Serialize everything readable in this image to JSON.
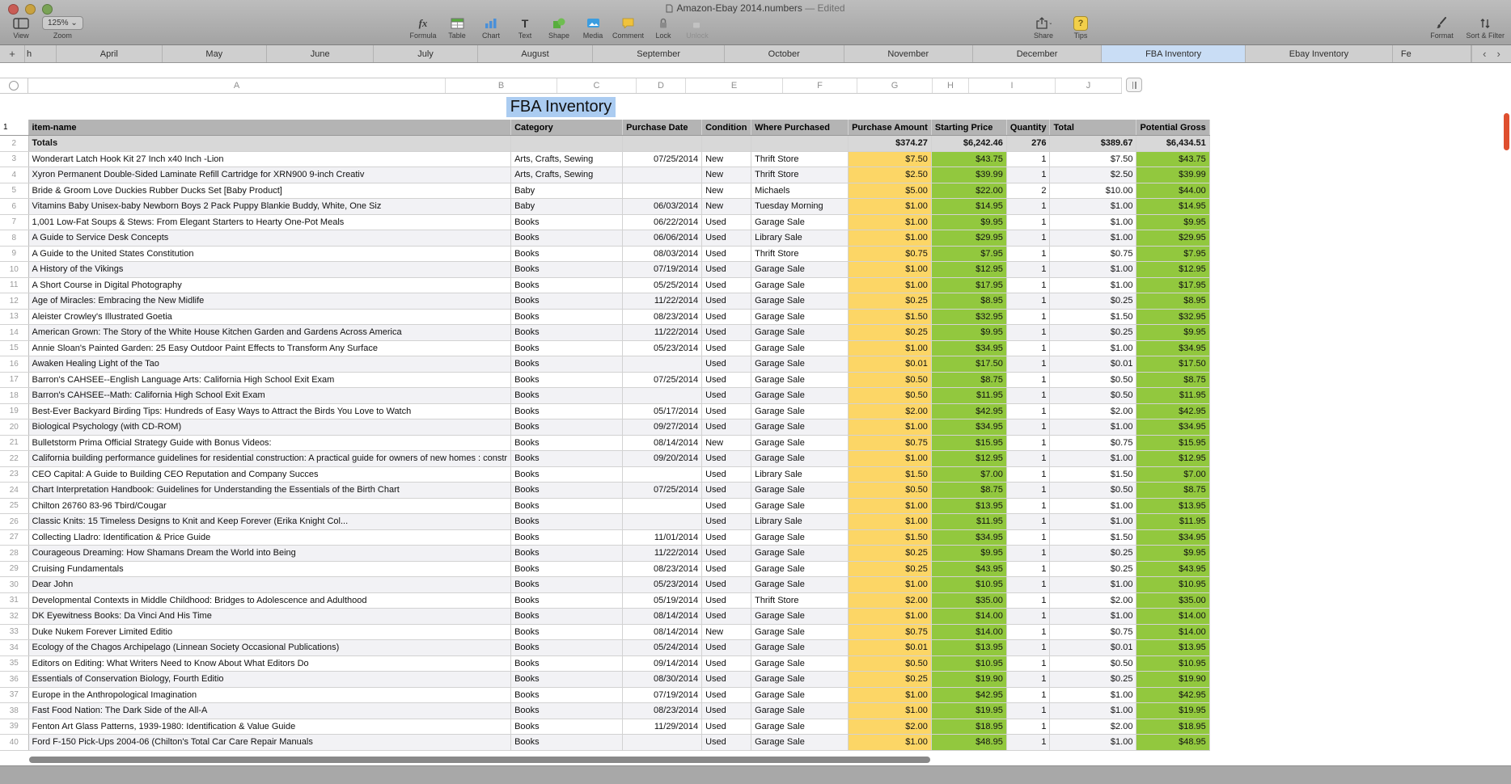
{
  "window": {
    "title": "Amazon-Ebay 2014.numbers",
    "edited": "— Edited"
  },
  "toolbar": {
    "view": {
      "label": "View"
    },
    "zoom": {
      "label": "Zoom",
      "value": "125%"
    },
    "formula": {
      "label": "Formula",
      "glyph": "fx"
    },
    "table": {
      "label": "Table"
    },
    "chart": {
      "label": "Chart"
    },
    "text": {
      "label": "Text",
      "glyph": "T"
    },
    "shape": {
      "label": "Shape"
    },
    "media": {
      "label": "Media"
    },
    "comment": {
      "label": "Comment"
    },
    "lock": {
      "label": "Lock"
    },
    "unlock": {
      "label": "Unlock"
    },
    "share": {
      "label": "Share"
    },
    "tips": {
      "label": "Tips",
      "glyph": "?"
    },
    "format": {
      "label": "Format"
    },
    "sort_filter": {
      "label": "Sort & Filter"
    }
  },
  "tabs": {
    "add": "+",
    "prev": "‹",
    "next": "›",
    "selected": "FBA Inventory",
    "items": [
      "h",
      "April",
      "May",
      "June",
      "July",
      "August",
      "September",
      "October",
      "November",
      "December",
      "FBA Inventory",
      "Ebay Inventory",
      "Fe"
    ]
  },
  "columns_bar": {
    "letters": [
      "A",
      "B",
      "C",
      "D",
      "E",
      "F",
      "G",
      "H",
      "I",
      "J"
    ]
  },
  "sheet": {
    "title": "FBA Inventory",
    "headers": [
      "item-name",
      "Category",
      "Purchase Date",
      "Condition",
      "Where Purchased",
      "Purchase Amount",
      "Starting Price",
      "Quantity",
      "Total",
      "Potential Gross"
    ],
    "totals": [
      "Totals",
      "",
      "",
      "",
      "",
      "$374.27",
      "$6,242.46",
      "276",
      "$389.67",
      "$6,434.51"
    ],
    "rows": [
      [
        "Wonderart Latch Hook Kit 27 Inch x40 Inch -Lion",
        "Arts, Crafts, Sewing",
        "07/25/2014",
        "New",
        "Thrift Store",
        "$7.50",
        "$43.75",
        "1",
        "$7.50",
        "$43.75"
      ],
      [
        "Xyron Permanent Double-Sided Laminate Refill Cartridge for XRN900 9-inch Creativ",
        "Arts, Crafts, Sewing",
        "",
        "New",
        "Thrift Store",
        "$2.50",
        "$39.99",
        "1",
        "$2.50",
        "$39.99"
      ],
      [
        "Bride & Groom Love Duckies Rubber Ducks Set [Baby Product]",
        "Baby",
        "",
        "New",
        "Michaels",
        "$5.00",
        "$22.00",
        "2",
        "$10.00",
        "$44.00"
      ],
      [
        "Vitamins Baby Unisex-baby Newborn Boys 2 Pack Puppy Blankie Buddy, White, One Siz",
        "Baby",
        "06/03/2014",
        "New",
        "Tuesday Morning",
        "$1.00",
        "$14.95",
        "1",
        "$1.00",
        "$14.95"
      ],
      [
        "1,001 Low-Fat Soups & Stews: From Elegant Starters to Hearty One-Pot Meals",
        "Books",
        "06/22/2014",
        "Used",
        "Garage Sale",
        "$1.00",
        "$9.95",
        "1",
        "$1.00",
        "$9.95"
      ],
      [
        "A Guide to Service Desk Concepts",
        "Books",
        "06/06/2014",
        "Used",
        "Library Sale",
        "$1.00",
        "$29.95",
        "1",
        "$1.00",
        "$29.95"
      ],
      [
        "A Guide to the United States Constitution",
        "Books",
        "08/03/2014",
        "Used",
        "Thrift Store",
        "$0.75",
        "$7.95",
        "1",
        "$0.75",
        "$7.95"
      ],
      [
        "A History of the Vikings",
        "Books",
        "07/19/2014",
        "Used",
        "Garage Sale",
        "$1.00",
        "$12.95",
        "1",
        "$1.00",
        "$12.95"
      ],
      [
        "A Short Course in Digital Photography",
        "Books",
        "05/25/2014",
        "Used",
        "Garage Sale",
        "$1.00",
        "$17.95",
        "1",
        "$1.00",
        "$17.95"
      ],
      [
        "Age of Miracles: Embracing the New Midlife",
        "Books",
        "11/22/2014",
        "Used",
        "Garage Sale",
        "$0.25",
        "$8.95",
        "1",
        "$0.25",
        "$8.95"
      ],
      [
        "Aleister Crowley's Illustrated Goetia",
        "Books",
        "08/23/2014",
        "Used",
        "Garage Sale",
        "$1.50",
        "$32.95",
        "1",
        "$1.50",
        "$32.95"
      ],
      [
        "American Grown: The Story of the White House Kitchen Garden and Gardens Across America",
        "Books",
        "11/22/2014",
        "Used",
        "Garage Sale",
        "$0.25",
        "$9.95",
        "1",
        "$0.25",
        "$9.95"
      ],
      [
        "Annie Sloan's Painted Garden: 25 Easy Outdoor Paint Effects to Transform Any Surface",
        "Books",
        "05/23/2014",
        "Used",
        "Garage Sale",
        "$1.00",
        "$34.95",
        "1",
        "$1.00",
        "$34.95"
      ],
      [
        "Awaken Healing Light of the Tao",
        "Books",
        "",
        "Used",
        "Garage Sale",
        "$0.01",
        "$17.50",
        "1",
        "$0.01",
        "$17.50"
      ],
      [
        "Barron's CAHSEE--English Language Arts: California High School Exit Exam",
        "Books",
        "07/25/2014",
        "Used",
        "Garage Sale",
        "$0.50",
        "$8.75",
        "1",
        "$0.50",
        "$8.75"
      ],
      [
        "Barron's CAHSEE--Math: California High School Exit Exam",
        "Books",
        "",
        "Used",
        "Garage Sale",
        "$0.50",
        "$11.95",
        "1",
        "$0.50",
        "$11.95"
      ],
      [
        "Best-Ever Backyard Birding Tips: Hundreds of Easy Ways to Attract the Birds You Love to Watch",
        "Books",
        "05/17/2014",
        "Used",
        "Garage Sale",
        "$2.00",
        "$42.95",
        "1",
        "$2.00",
        "$42.95"
      ],
      [
        "Biological Psychology (with CD-ROM)",
        "Books",
        "09/27/2014",
        "Used",
        "Garage Sale",
        "$1.00",
        "$34.95",
        "1",
        "$1.00",
        "$34.95"
      ],
      [
        "Bulletstorm Prima Official Strategy Guide with Bonus Videos:",
        "Books",
        "08/14/2014",
        "New",
        "Garage Sale",
        "$0.75",
        "$15.95",
        "1",
        "$0.75",
        "$15.95"
      ],
      [
        "California building performance guidelines for residential construction: A practical guide for owners of new homes : constr",
        "Books",
        "09/20/2014",
        "Used",
        "Garage Sale",
        "$1.00",
        "$12.95",
        "1",
        "$1.00",
        "$12.95"
      ],
      [
        "CEO Capital: A Guide to Building CEO Reputation and Company Succes",
        "Books",
        "",
        "Used",
        "Library Sale",
        "$1.50",
        "$7.00",
        "1",
        "$1.50",
        "$7.00"
      ],
      [
        "Chart Interpretation Handbook: Guidelines for Understanding the Essentials of the Birth Chart",
        "Books",
        "07/25/2014",
        "Used",
        "Garage Sale",
        "$0.50",
        "$8.75",
        "1",
        "$0.50",
        "$8.75"
      ],
      [
        "Chilton 26760 83-96 Tbird/Cougar",
        "Books",
        "",
        "Used",
        "Garage Sale",
        "$1.00",
        "$13.95",
        "1",
        "$1.00",
        "$13.95"
      ],
      [
        "Classic Knits: 15 Timeless Designs to Knit and Keep Forever (Erika Knight Col...",
        "Books",
        "",
        "Used",
        "Library Sale",
        "$1.00",
        "$11.95",
        "1",
        "$1.00",
        "$11.95"
      ],
      [
        "Collecting Lladro: Identification & Price Guide",
        "Books",
        "11/01/2014",
        "Used",
        "Garage Sale",
        "$1.50",
        "$34.95",
        "1",
        "$1.50",
        "$34.95"
      ],
      [
        "Courageous Dreaming: How Shamans Dream the World into Being",
        "Books",
        "11/22/2014",
        "Used",
        "Garage Sale",
        "$0.25",
        "$9.95",
        "1",
        "$0.25",
        "$9.95"
      ],
      [
        "Cruising Fundamentals",
        "Books",
        "08/23/2014",
        "Used",
        "Garage Sale",
        "$0.25",
        "$43.95",
        "1",
        "$0.25",
        "$43.95"
      ],
      [
        "Dear John",
        "Books",
        "05/23/2014",
        "Used",
        "Garage Sale",
        "$1.00",
        "$10.95",
        "1",
        "$1.00",
        "$10.95"
      ],
      [
        "Developmental Contexts in Middle Childhood: Bridges to Adolescence and Adulthood",
        "Books",
        "05/19/2014",
        "Used",
        "Thrift Store",
        "$2.00",
        "$35.00",
        "1",
        "$2.00",
        "$35.00"
      ],
      [
        "DK Eyewitness Books: Da Vinci And His Time",
        "Books",
        "08/14/2014",
        "Used",
        "Garage Sale",
        "$1.00",
        "$14.00",
        "1",
        "$1.00",
        "$14.00"
      ],
      [
        "Duke Nukem Forever Limited Editio",
        "Books",
        "08/14/2014",
        "New",
        "Garage Sale",
        "$0.75",
        "$14.00",
        "1",
        "$0.75",
        "$14.00"
      ],
      [
        "Ecology of the Chagos Archipelago (Linnean Society Occasional Publications)",
        "Books",
        "05/24/2014",
        "Used",
        "Garage Sale",
        "$0.01",
        "$13.95",
        "1",
        "$0.01",
        "$13.95"
      ],
      [
        "Editors on Editing: What Writers Need to Know About What Editors Do",
        "Books",
        "09/14/2014",
        "Used",
        "Garage Sale",
        "$0.50",
        "$10.95",
        "1",
        "$0.50",
        "$10.95"
      ],
      [
        "Essentials of Conservation Biology, Fourth Editio",
        "Books",
        "08/30/2014",
        "Used",
        "Garage Sale",
        "$0.25",
        "$19.90",
        "1",
        "$0.25",
        "$19.90"
      ],
      [
        "Europe in the Anthropological Imagination",
        "Books",
        "07/19/2014",
        "Used",
        "Garage Sale",
        "$1.00",
        "$42.95",
        "1",
        "$1.00",
        "$42.95"
      ],
      [
        "Fast Food Nation: The Dark Side of the All-A",
        "Books",
        "08/23/2014",
        "Used",
        "Garage Sale",
        "$1.00",
        "$19.95",
        "1",
        "$1.00",
        "$19.95"
      ],
      [
        "Fenton Art Glass Patterns, 1939-1980: Identification & Value Guide",
        "Books",
        "11/29/2014",
        "Used",
        "Garage Sale",
        "$2.00",
        "$18.95",
        "1",
        "$2.00",
        "$18.95"
      ],
      [
        "Ford F-150 Pick-Ups 2004-06 (Chilton's Total Car Care Repair Manuals",
        "Books",
        "",
        "Used",
        "Garage Sale",
        "$1.00",
        "$48.95",
        "1",
        "$1.00",
        "$48.95"
      ]
    ]
  }
}
